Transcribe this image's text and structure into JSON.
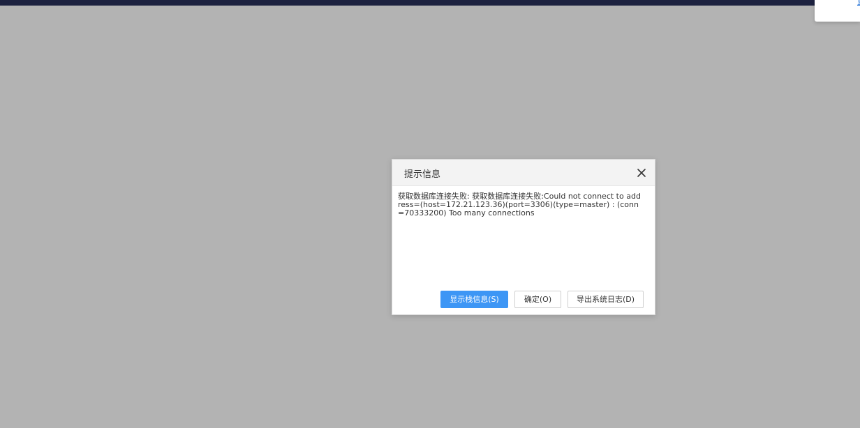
{
  "corner_popup": {
    "link_text": "重"
  },
  "dialog": {
    "title": "提示信息",
    "close_icon": "close-icon",
    "message": "获取数据库连接失败: 获取数据库连接失败:Could not connect to address=(host=172.21.123.36)(port=3306)(type=master) : (conn=70333200) Too many connections",
    "buttons": {
      "show_stack": "显示栈信息(S)",
      "ok": "确定(O)",
      "export_log": "导出系统日志(D)"
    }
  },
  "colors": {
    "overlay": "#b3b3b3",
    "top_bar": "#1d2240",
    "primary": "#3d96f5"
  }
}
